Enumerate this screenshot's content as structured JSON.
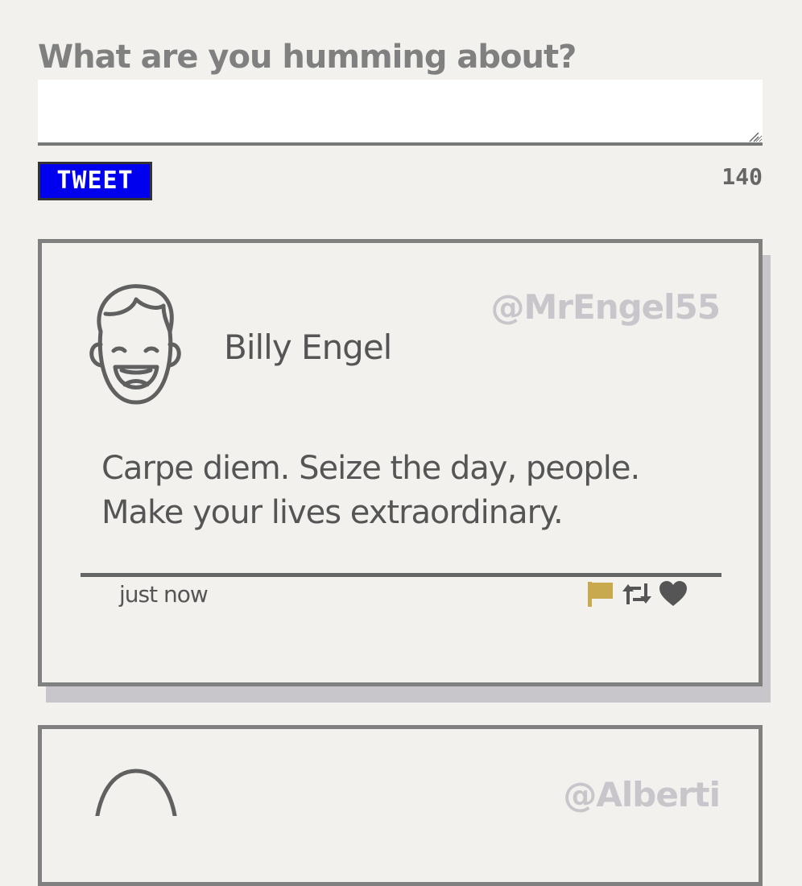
{
  "compose": {
    "label": "What are you humming about?",
    "textarea_value": "",
    "button_label": "TWEET",
    "char_count": "140"
  },
  "tweets": [
    {
      "display_name": "Billy Engel",
      "handle": "@MrEngel55",
      "text": "Carpe diem. Seize the day, people. Make your lives extraordinary.",
      "timestamp": "just now",
      "avatar_icon": "smiling-face-icon",
      "actions": [
        "flag-icon",
        "retweet-icon",
        "heart-icon"
      ]
    },
    {
      "handle": "@Alberti",
      "avatar_icon": "face-icon"
    }
  ],
  "colors": {
    "background": "#f3f1ed",
    "tweet_button": "#0000ee",
    "handle": "#c8c6cb",
    "flag": "#c9a94e",
    "card_shadow": "#c8c6cb"
  }
}
